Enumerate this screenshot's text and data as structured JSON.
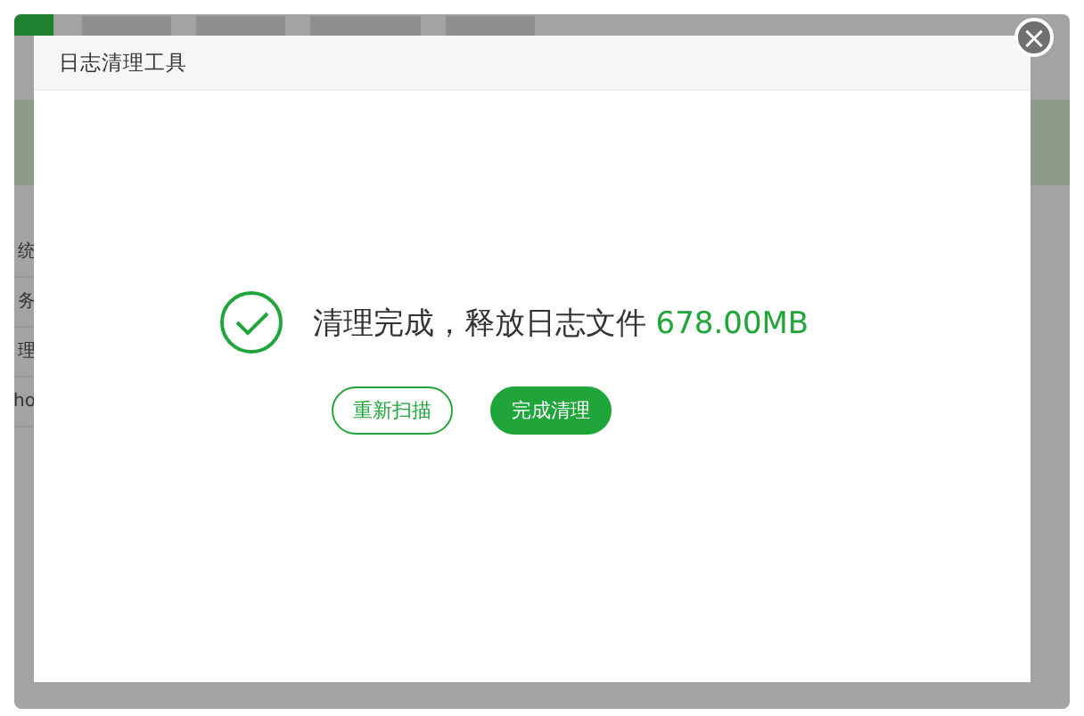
{
  "background": {
    "tabs": [
      {
        "selected": true
      },
      {
        "selected": false
      },
      {
        "selected": false
      },
      {
        "selected": false
      },
      {
        "selected": false
      }
    ],
    "sidebar_items": [
      "统",
      "务",
      "理",
      "ho"
    ]
  },
  "dialog": {
    "title": "日志清理工具",
    "close": "×",
    "message": "清理完成，释放日志文件",
    "amount": "678.00MB",
    "buttons": [
      {
        "label": "重新扫描",
        "kind": "outline"
      },
      {
        "label": "完成清理",
        "kind": "primary"
      }
    ]
  }
}
